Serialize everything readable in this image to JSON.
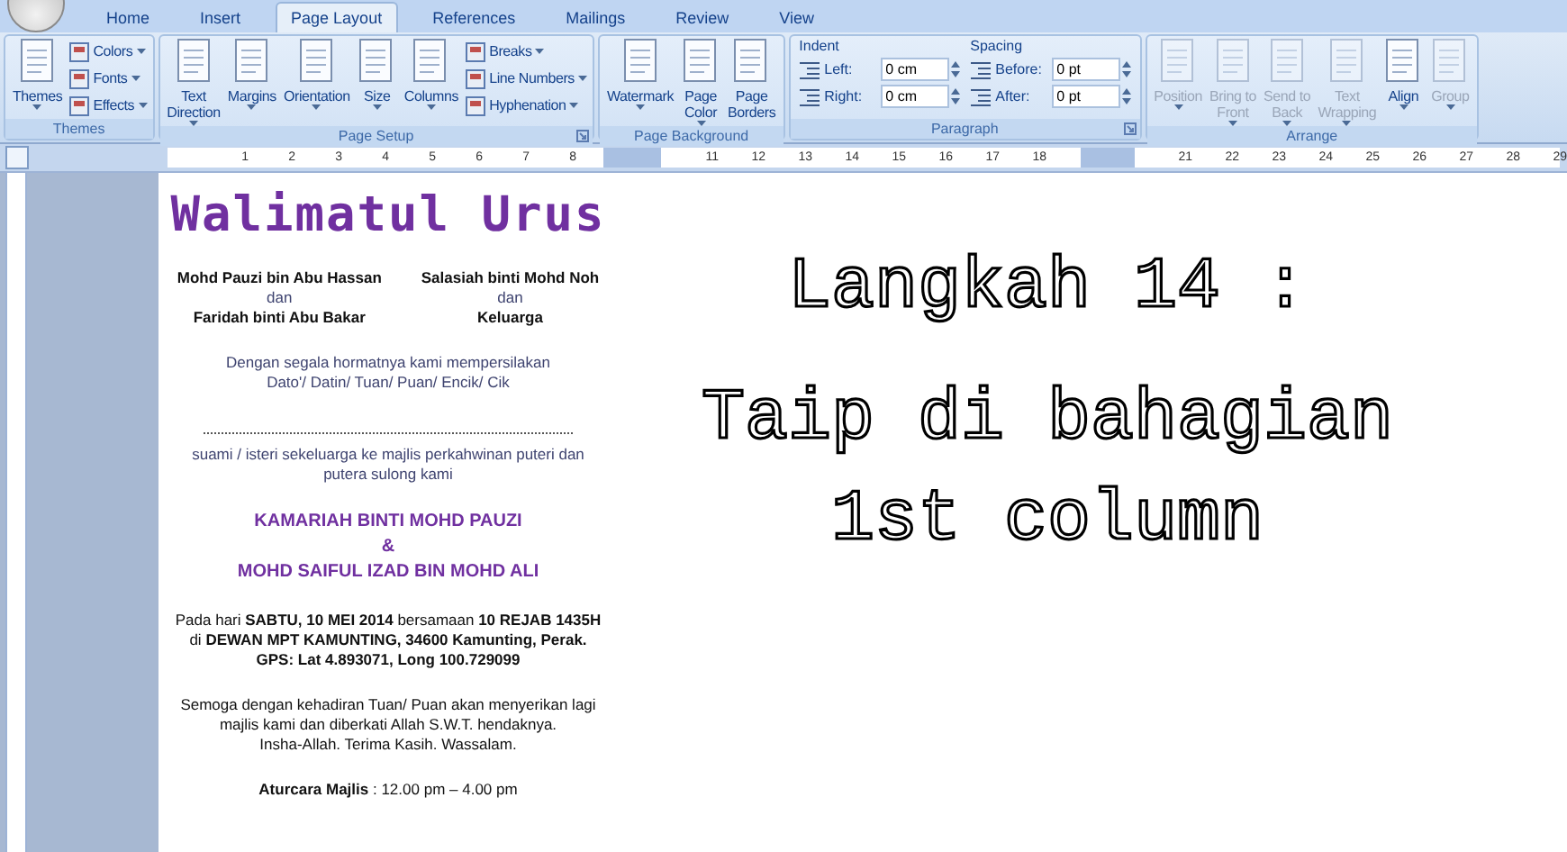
{
  "tabs": [
    {
      "label": "Home",
      "selected": false
    },
    {
      "label": "Insert",
      "selected": false
    },
    {
      "label": "Page Layout",
      "selected": true
    },
    {
      "label": "References",
      "selected": false
    },
    {
      "label": "Mailings",
      "selected": false
    },
    {
      "label": "Review",
      "selected": false
    },
    {
      "label": "View",
      "selected": false
    }
  ],
  "ribbon": {
    "groups": [
      {
        "label": "Themes",
        "launcher": false,
        "items": [
          {
            "kind": "large",
            "lines": [
              "Themes"
            ],
            "dropdown": true,
            "disabled": false
          },
          {
            "kind": "stack",
            "items": [
              {
                "label": "Colors",
                "dropdown": true
              },
              {
                "label": "Fonts",
                "dropdown": true
              },
              {
                "label": "Effects",
                "dropdown": true
              }
            ]
          }
        ]
      },
      {
        "label": "Page Setup",
        "launcher": true,
        "items": [
          {
            "kind": "large",
            "lines": [
              "Text",
              "Direction"
            ],
            "dropdown": true,
            "disabled": false
          },
          {
            "kind": "large",
            "lines": [
              "Margins"
            ],
            "dropdown": true,
            "disabled": false
          },
          {
            "kind": "large",
            "lines": [
              "Orientation"
            ],
            "dropdown": true,
            "disabled": false
          },
          {
            "kind": "large",
            "lines": [
              "Size"
            ],
            "dropdown": true,
            "disabled": false
          },
          {
            "kind": "large",
            "lines": [
              "Columns"
            ],
            "dropdown": true,
            "disabled": false
          },
          {
            "kind": "stack",
            "items": [
              {
                "label": "Breaks",
                "dropdown": true
              },
              {
                "label": "Line Numbers",
                "dropdown": true
              },
              {
                "label": "Hyphenation",
                "dropdown": true
              }
            ]
          }
        ]
      },
      {
        "label": "Page Background",
        "launcher": false,
        "items": [
          {
            "kind": "large",
            "lines": [
              "Watermark"
            ],
            "dropdown": true,
            "disabled": false
          },
          {
            "kind": "large",
            "lines": [
              "Page",
              "Color"
            ],
            "dropdown": true,
            "disabled": false
          },
          {
            "kind": "large",
            "lines": [
              "Page",
              "Borders"
            ],
            "dropdown": false,
            "disabled": false
          }
        ]
      },
      {
        "label": "Paragraph",
        "launcher": true,
        "items": [
          {
            "kind": "fields",
            "title": "Indent",
            "fields": [
              {
                "label": "Left:",
                "value": "0 cm"
              },
              {
                "label": "Right:",
                "value": "0 cm"
              }
            ]
          },
          {
            "kind": "fields",
            "title": "Spacing",
            "fields": [
              {
                "label": "Before:",
                "value": "0 pt"
              },
              {
                "label": "After:",
                "value": "0 pt"
              }
            ]
          }
        ]
      },
      {
        "label": "Arrange",
        "launcher": false,
        "items": [
          {
            "kind": "large",
            "lines": [
              "Position"
            ],
            "dropdown": true,
            "disabled": true
          },
          {
            "kind": "large",
            "lines": [
              "Bring to",
              "Front"
            ],
            "dropdown": true,
            "disabled": true
          },
          {
            "kind": "large",
            "lines": [
              "Send to",
              "Back"
            ],
            "dropdown": true,
            "disabled": true
          },
          {
            "kind": "large",
            "lines": [
              "Text",
              "Wrapping"
            ],
            "dropdown": true,
            "disabled": true
          },
          {
            "kind": "large",
            "lines": [
              "Align"
            ],
            "dropdown": true,
            "disabled": false
          },
          {
            "kind": "large",
            "lines": [
              "Group"
            ],
            "dropdown": true,
            "disabled": true
          }
        ]
      }
    ]
  },
  "ruler": {
    "segments": [
      {
        "kind": "text",
        "numbers": [
          "1",
          "2",
          "3",
          "4",
          "5",
          "6",
          "7",
          "8"
        ]
      },
      {
        "kind": "gap"
      },
      {
        "kind": "text",
        "numbers": [
          "11",
          "12",
          "13",
          "14",
          "15",
          "16",
          "17",
          "18"
        ]
      },
      {
        "kind": "gap"
      },
      {
        "kind": "text",
        "numbers": [
          "21",
          "22",
          "23",
          "24",
          "25",
          "26",
          "27",
          "28",
          "29"
        ]
      }
    ]
  },
  "document": {
    "blocks": [
      {
        "kind": "title",
        "text": "Walimatul Urus"
      },
      {
        "kind": "parents",
        "columns": [
          [
            {
              "text": "Mohd Pauzi bin Abu Hassan",
              "bold": true
            },
            {
              "text": "dan",
              "bold": false
            },
            {
              "text": "Faridah binti Abu Bakar",
              "bold": true
            }
          ],
          [
            {
              "text": "Salasiah binti Mohd Noh",
              "bold": true
            },
            {
              "text": "dan",
              "bold": false
            },
            {
              "text": "Keluarga",
              "bold": true
            }
          ]
        ]
      },
      {
        "kind": "paragraph",
        "color": "#3f4470",
        "lines": [
          {
            "text": "Dengan segala hormatnya kami mempersilakan",
            "bold": false
          },
          {
            "text": "Dato'/ Datin/ Tuan/ Puan/ Encik/ Cik",
            "bold": false
          }
        ]
      },
      {
        "kind": "rule"
      },
      {
        "kind": "paragraph",
        "color": "#3f4470",
        "lines": [
          {
            "text": "suami / isteri sekeluarga ke majlis perkahwinan puteri dan",
            "bold": false
          },
          {
            "text": "putera sulong kami",
            "bold": false
          }
        ]
      },
      {
        "kind": "heading",
        "color": "#7030a0",
        "lines": [
          {
            "text": "KAMARIAH BINTI MOHD PAUZI",
            "bold": true
          },
          {
            "text": "&",
            "bold": true
          },
          {
            "text": "MOHD SAIFUL IZAD BIN MOHD ALI",
            "bold": true
          }
        ]
      },
      {
        "kind": "paragraph",
        "color": "#111111",
        "lines": [
          {
            "text": "Pada hari **SABTU, 10 MEI 2014** bersamaan **10 REJAB 1435H**",
            "bold": false
          },
          {
            "text": "di **DEWAN MPT KAMUNTING, 34600 Kamunting, Perak.**",
            "bold": false
          },
          {
            "text": "GPS: Lat 4.893071, Long 100.729099",
            "bold": true
          }
        ]
      },
      {
        "kind": "paragraph",
        "color": "#111111",
        "lines": [
          {
            "text": "Semoga dengan kehadiran Tuan/ Puan akan menyerikan lagi",
            "bold": false
          },
          {
            "text": "majlis kami dan diberkati Allah S.W.T. hendaknya.",
            "bold": false
          },
          {
            "text": "Insha-Allah. Terima Kasih. Wassalam.",
            "bold": false
          }
        ]
      },
      {
        "kind": "paragraph",
        "color": "#111111",
        "lines": [
          {
            "text": "**Aturcara Majlis** : 12.00 pm – 4.00 pm",
            "bold": false
          }
        ]
      }
    ],
    "overlay_lines": [
      "Langkah 14 :",
      "Taip di bahagian",
      "1st column"
    ]
  }
}
